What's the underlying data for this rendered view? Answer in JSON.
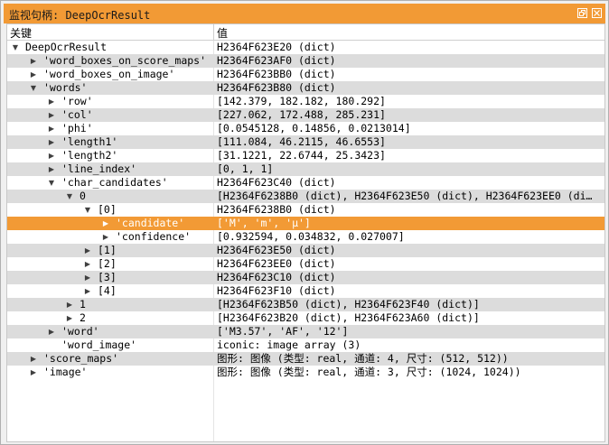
{
  "window": {
    "title": "监视句柄: DeepOcrResult",
    "restore_icon": "restore-icon",
    "close_icon": "close-icon",
    "title_color": "#f29a35"
  },
  "header": {
    "key": "关键",
    "value": "值"
  },
  "rows": [
    {
      "depth": 0,
      "arrow": "open",
      "key": "DeepOcrResult",
      "value": "H2364F623E20 (dict)"
    },
    {
      "depth": 1,
      "arrow": "closed",
      "key": "'word_boxes_on_score_maps'",
      "value": "H2364F623AF0 (dict)"
    },
    {
      "depth": 1,
      "arrow": "closed",
      "key": "'word_boxes_on_image'",
      "value": "H2364F623BB0 (dict)"
    },
    {
      "depth": 1,
      "arrow": "open",
      "key": "'words'",
      "value": "H2364F623B80 (dict)"
    },
    {
      "depth": 2,
      "arrow": "closed",
      "key": "'row'",
      "value": "[142.379, 182.182, 180.292]"
    },
    {
      "depth": 2,
      "arrow": "closed",
      "key": "'col'",
      "value": "[227.062, 172.488, 285.231]"
    },
    {
      "depth": 2,
      "arrow": "closed",
      "key": "'phi'",
      "value": "[0.0545128, 0.14856, 0.0213014]"
    },
    {
      "depth": 2,
      "arrow": "closed",
      "key": "'length1'",
      "value": "[111.084, 46.2115, 46.6553]"
    },
    {
      "depth": 2,
      "arrow": "closed",
      "key": "'length2'",
      "value": "[31.1221, 22.6744, 25.3423]"
    },
    {
      "depth": 2,
      "arrow": "closed",
      "key": "'line_index'",
      "value": "[0, 1, 1]"
    },
    {
      "depth": 2,
      "arrow": "open",
      "key": "'char_candidates'",
      "value": "H2364F623C40 (dict)"
    },
    {
      "depth": 3,
      "arrow": "open",
      "key": "0",
      "value": "[H2364F6238B0 (dict), H2364F623E50 (dict), H2364F623EE0 (di…"
    },
    {
      "depth": 4,
      "arrow": "open",
      "key": "[0]",
      "value": "H2364F6238B0 (dict)"
    },
    {
      "depth": 5,
      "arrow": "closed",
      "key": "'candidate'",
      "value": "['M', 'm', 'µ']",
      "selected": true
    },
    {
      "depth": 5,
      "arrow": "closed",
      "key": "'confidence'",
      "value": "[0.932594, 0.034832, 0.027007]"
    },
    {
      "depth": 4,
      "arrow": "closed",
      "key": "[1]",
      "value": "H2364F623E50 (dict)"
    },
    {
      "depth": 4,
      "arrow": "closed",
      "key": "[2]",
      "value": "H2364F623EE0 (dict)"
    },
    {
      "depth": 4,
      "arrow": "closed",
      "key": "[3]",
      "value": "H2364F623C10 (dict)"
    },
    {
      "depth": 4,
      "arrow": "closed",
      "key": "[4]",
      "value": "H2364F623F10 (dict)"
    },
    {
      "depth": 3,
      "arrow": "closed",
      "key": "1",
      "value": "[H2364F623B50 (dict), H2364F623F40 (dict)]"
    },
    {
      "depth": 3,
      "arrow": "closed",
      "key": "2",
      "value": "[H2364F623B20 (dict), H2364F623A60 (dict)]"
    },
    {
      "depth": 2,
      "arrow": "closed",
      "key": "'word'",
      "value": "['M3.57', 'AF', '12']"
    },
    {
      "depth": 2,
      "arrow": "none",
      "key": "'word_image'",
      "value": "iconic: image array (3)"
    },
    {
      "depth": 1,
      "arrow": "closed",
      "key": "'score_maps'",
      "value": "图形: 图像 (类型: real, 通道: 4, 尺寸: (512, 512))"
    },
    {
      "depth": 1,
      "arrow": "closed",
      "key": "'image'",
      "value": "图形: 图像 (类型: real, 通道: 3, 尺寸: (1024, 1024))"
    }
  ]
}
